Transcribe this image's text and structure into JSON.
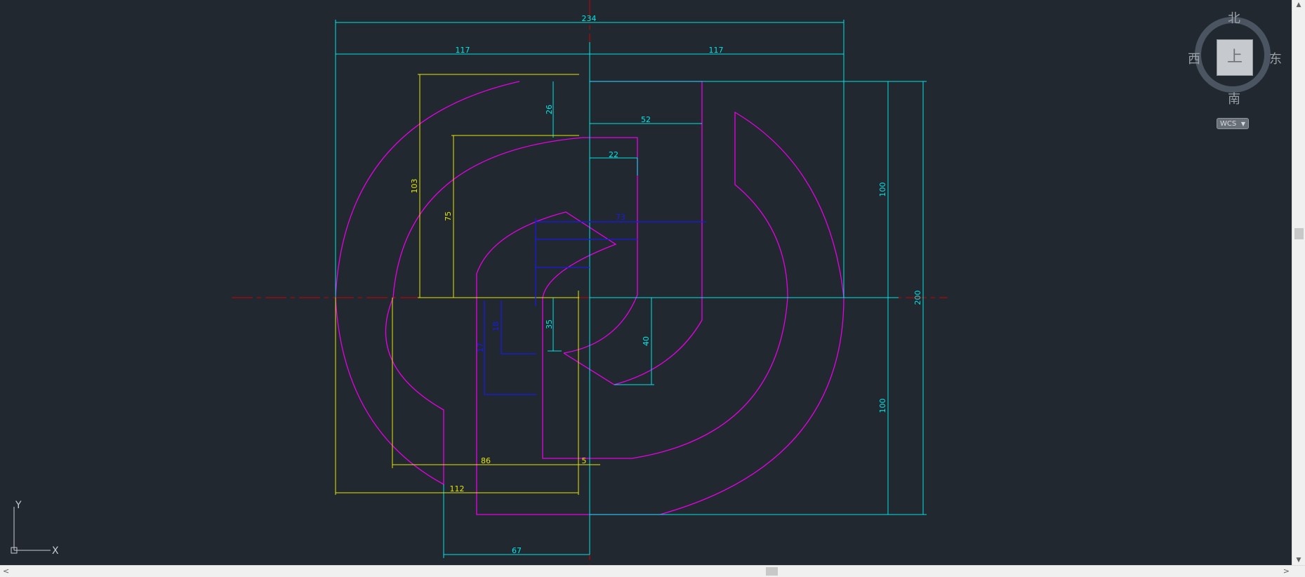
{
  "colors": {
    "background": "#212830",
    "dimension_cyan": "#00e5e5",
    "dimension_yellow": "#e5e500",
    "profile_magenta": "#e600e6",
    "hatch_blue": "#1a1ae6",
    "centerline_red": "#cc0000"
  },
  "drawing": {
    "dimensions": {
      "overall_width": "234",
      "left_half": "117",
      "right_half": "117",
      "top_offset": "26",
      "slot_width": "52",
      "inner_width": "22",
      "upper_height": "100",
      "lower_height": "100",
      "total_height": "200",
      "outer_height_yellow": "103",
      "inner_height_yellow": "75",
      "lower_depth": "35",
      "tail_depth": "40",
      "base_width": "86",
      "gap": "5",
      "bottom_width": "112",
      "stem_width": "67",
      "blue_top": "73",
      "blue_a": "18",
      "blue_b": "17"
    }
  },
  "viewcube": {
    "face_label": "上",
    "north": "北",
    "south": "南",
    "west": "西",
    "east": "东",
    "wcs_label": "WCS",
    "icon": "viewcube-icon"
  },
  "ucs": {
    "x_label": "X",
    "y_label": "Y",
    "icon": "ucs-icon"
  },
  "scrollbars": {
    "up": "▲",
    "down": "▼",
    "left": "<",
    "right": ">"
  }
}
